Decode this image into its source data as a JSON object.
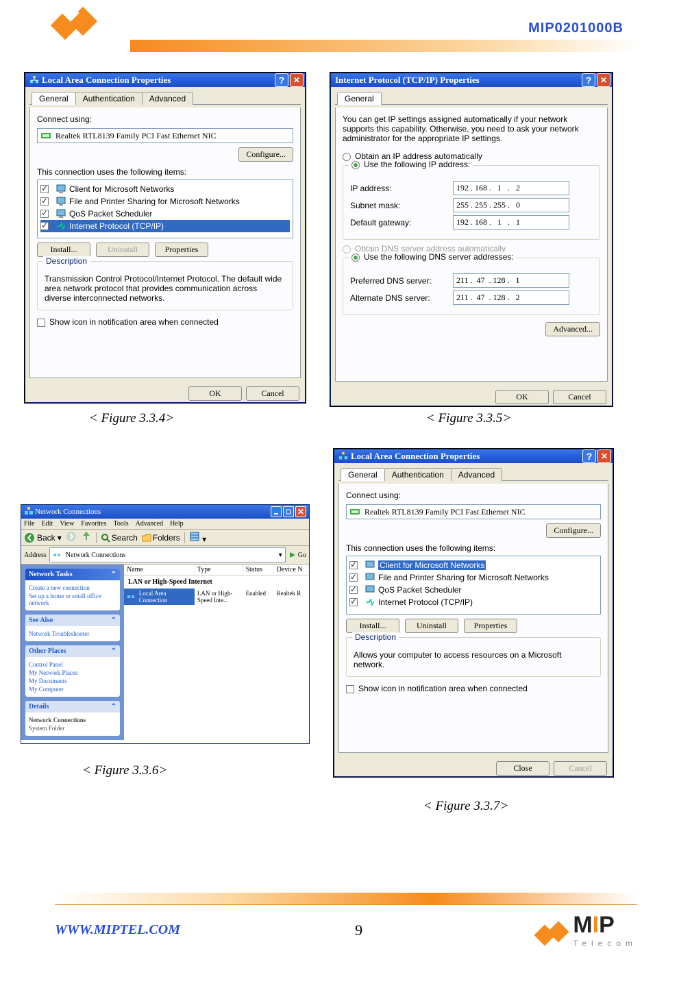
{
  "header": {
    "doc_code": "MIP0201000B"
  },
  "figures": {
    "fig334": {
      "caption": "< Figure 3.3.4>",
      "title": "Local Area Connection Properties",
      "tabs": [
        "General",
        "Authentication",
        "Advanced"
      ],
      "connect_using_label": "Connect using:",
      "adapter": "Realtek RTL8139 Family PCI Fast Ethernet NIC",
      "configure_btn": "Configure...",
      "uses_label": "This connection uses the following items:",
      "items": [
        "Client for Microsoft Networks",
        "File and Printer Sharing for Microsoft Networks",
        "QoS Packet Scheduler",
        "Internet Protocol (TCP/IP)"
      ],
      "install_btn": "Install...",
      "uninstall_btn": "Uninstall",
      "properties_btn": "Properties",
      "desc_legend": "Description",
      "desc_text": "Transmission Control Protocol/Internet Protocol. The default wide area network protocol that provides communication across diverse interconnected networks.",
      "show_icon": "Show icon in notification area when connected",
      "ok_btn": "OK",
      "cancel_btn": "Cancel"
    },
    "fig335": {
      "caption": "< Figure 3.3.5>",
      "title": "Internet Protocol (TCP/IP) Properties",
      "tabs": [
        "General"
      ],
      "intro": "You can get IP settings assigned automatically if your network supports this capability. Otherwise, you need to ask your network administrator for the appropriate IP settings.",
      "opt_auto_ip": "Obtain an IP address automatically",
      "opt_use_ip": "Use the following IP address:",
      "ip_label": "IP address:",
      "ip_value": "192 . 168 .   1   .   2",
      "mask_label": "Subnet mask:",
      "mask_value": "255 . 255 . 255 .   0",
      "gw_label": "Default gateway:",
      "gw_value": "192 . 168 .   1   .   1",
      "opt_auto_dns": "Obtain DNS server address automatically",
      "opt_use_dns": "Use the following DNS server addresses:",
      "pdns_label": "Preferred DNS server:",
      "pdns_value": "211 .  47  . 128 .   1",
      "adns_label": "Alternate DNS server:",
      "adns_value": "211 .  47  . 128 .   2",
      "advanced_btn": "Advanced...",
      "ok_btn": "OK",
      "cancel_btn": "Cancel"
    },
    "fig336": {
      "caption": "< Figure 3.3.6>",
      "title": "Network Connections",
      "menubar": [
        "File",
        "Edit",
        "View",
        "Favorites",
        "Tools",
        "Advanced",
        "Help"
      ],
      "toolbar_back": "Back",
      "toolbar_search": "Search",
      "toolbar_folders": "Folders",
      "addr_label": "Address",
      "addr_value": "Network Connections",
      "go_btn": "Go",
      "cols": [
        "Name",
        "Type",
        "Status",
        "Device N"
      ],
      "section": "LAN or High-Speed Internet",
      "row_name": "Local Area Connection",
      "row_type": "LAN or High-Speed Inte...",
      "row_status": "Enabled",
      "row_device": "Realtek R",
      "tasks": {
        "t1_title": "Network Tasks",
        "t1_items": [
          "Create a new connection",
          "Set up a home or small office network"
        ],
        "t2_title": "See Also",
        "t2_items": [
          "Network Troubleshooter"
        ],
        "t3_title": "Other Places",
        "t3_items": [
          "Control Panel",
          "My Network Places",
          "My Documents",
          "My Computer"
        ],
        "t4_title": "Details",
        "t4_items": [
          "Network Connections",
          "System Folder"
        ]
      }
    },
    "fig337": {
      "caption": "< Figure 3.3.7>",
      "title": "Local Area Connection Properties",
      "tabs": [
        "General",
        "Authentication",
        "Advanced"
      ],
      "connect_using_label": "Connect using:",
      "adapter": "Realtek RTL8139 Family PCI Fast Ethernet NIC",
      "configure_btn": "Configure...",
      "uses_label": "This connection uses the following items:",
      "items": [
        "Client for Microsoft Networks",
        "File and Printer Sharing for Microsoft Networks",
        "QoS Packet Scheduler",
        "Internet Protocol (TCP/IP)"
      ],
      "install_btn": "Install...",
      "uninstall_btn": "Uninstall",
      "properties_btn": "Properties",
      "desc_legend": "Description",
      "desc_text": "Allows your computer to access resources on a Microsoft network.",
      "show_icon": "Show icon in notification area when connected",
      "close_btn": "Close",
      "cancel_btn": "Cancel"
    }
  },
  "footer": {
    "url": "WWW.MIPTEL.COM",
    "page_num": "9",
    "brand": "MIP",
    "brand_sub": "Telecom"
  }
}
